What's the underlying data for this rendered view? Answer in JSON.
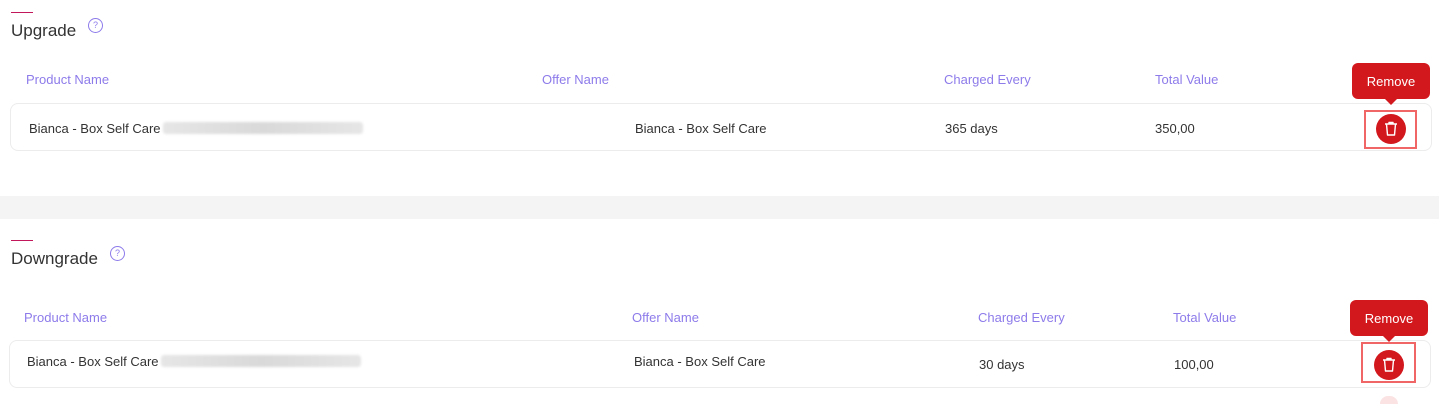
{
  "upgrade": {
    "title": "Upgrade",
    "help_icon": "question-circle-icon",
    "headers": {
      "product_name": "Product Name",
      "offer_name": "Offer Name",
      "charged_every": "Charged Every",
      "total_value": "Total Value"
    },
    "rows": [
      {
        "product_name": "Bianca - Box Self Care",
        "offer_name": "Bianca - Box Self Care",
        "charged_every": "365 days",
        "total_value": "350,00"
      }
    ],
    "remove_tooltip": "Remove"
  },
  "downgrade": {
    "title": "Downgrade",
    "help_icon": "question-circle-icon",
    "headers": {
      "product_name": "Product Name",
      "offer_name": "Offer Name",
      "charged_every": "Charged Every",
      "total_value": "Total Value"
    },
    "rows": [
      {
        "product_name": "Bianca - Box Self Care",
        "offer_name": "Bianca - Box Self Care",
        "charged_every": "30 days",
        "total_value": "100,00"
      }
    ],
    "remove_tooltip": "Remove"
  },
  "colors": {
    "accent": "#8e7bea",
    "danger": "#d3181d",
    "highlight": "#f06565",
    "separator": "#f4f4f4"
  }
}
